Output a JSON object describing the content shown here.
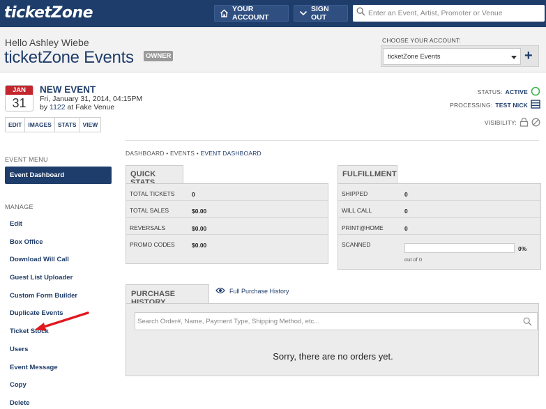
{
  "topbar": {
    "logo": "ticketZone",
    "your_account": "YOUR ACCOUNT",
    "sign_out": "SIGN OUT",
    "search_placeholder": "Enter an Event, Artist, Promoter or Venue",
    "bg_color": "#1f3d6a"
  },
  "header": {
    "greeting": "Hello Ashley Wiebe",
    "org_name": "ticketZone Events",
    "owner_badge": "OWNER",
    "choose_label": "CHOOSE YOUR ACCOUNT:",
    "selected_account": "ticketZone Events",
    "add_symbol": "+"
  },
  "event": {
    "month": "JAN",
    "day": "31",
    "name": "NEW EVENT",
    "datetime": "Fri, January 31, 2014, 04:15PM",
    "by_prefix": "by",
    "by_id": "1122",
    "venue_text": "at Fake Venue",
    "actions": [
      "EDIT",
      "IMAGES",
      "STATS",
      "VIEW"
    ],
    "status_label": "STATUS:",
    "status_value": "ACTIVE",
    "processing_label": "PROCESSING:",
    "processing_value": "TEST NICK",
    "visibility_label": "VISIBILITY:"
  },
  "sidebar": {
    "event_menu_heading": "EVENT MENU",
    "active_item": "Event Dashboard",
    "manage_heading": "MANAGE",
    "items": [
      "Edit",
      "Box Office",
      "Download Will Call",
      "Guest List Uploader",
      "Custom Form Builder",
      "Duplicate Events",
      "Ticket Stock",
      "Users",
      "Event Message",
      "Copy",
      "Delete"
    ]
  },
  "breadcrumb": {
    "dashboard": "DASHBOARD",
    "events": "EVENTS",
    "current": "EVENT DASHBOARD",
    "separator": "•"
  },
  "quick_stats": {
    "title": "QUICK STATS",
    "rows": [
      {
        "label": "TOTAL TICKETS",
        "value": "0"
      },
      {
        "label": "TOTAL SALES",
        "value": "$0.00"
      },
      {
        "label": "REVERSALS",
        "value": "$0.00"
      },
      {
        "label": "PROMO CODES",
        "value": "$0.00"
      }
    ]
  },
  "fulfillment": {
    "title": "FULFILLMENT",
    "rows": [
      {
        "label": "SHIPPED",
        "value": "0"
      },
      {
        "label": "WILL CALL",
        "value": "0"
      },
      {
        "label": "PRINT@HOME",
        "value": "0"
      }
    ],
    "scanned_label": "SCANNED",
    "scanned_percent": "0%",
    "scanned_fraction": 0,
    "scanned_out_of": "out of 0"
  },
  "purchase_history": {
    "title": "PURCHASE HISTORY",
    "full_link": "Full Purchase History",
    "search_placeholder": "Search Order#, Name, Payment Type, Shipping Method, etc...",
    "empty_message": "Sorry, there are no orders yet."
  },
  "colors": {
    "brand_navy": "#1f3d6a",
    "calendar_red": "#c4262e",
    "active_green": "#3cb54a",
    "annotation_arrow": "#e0191f"
  }
}
